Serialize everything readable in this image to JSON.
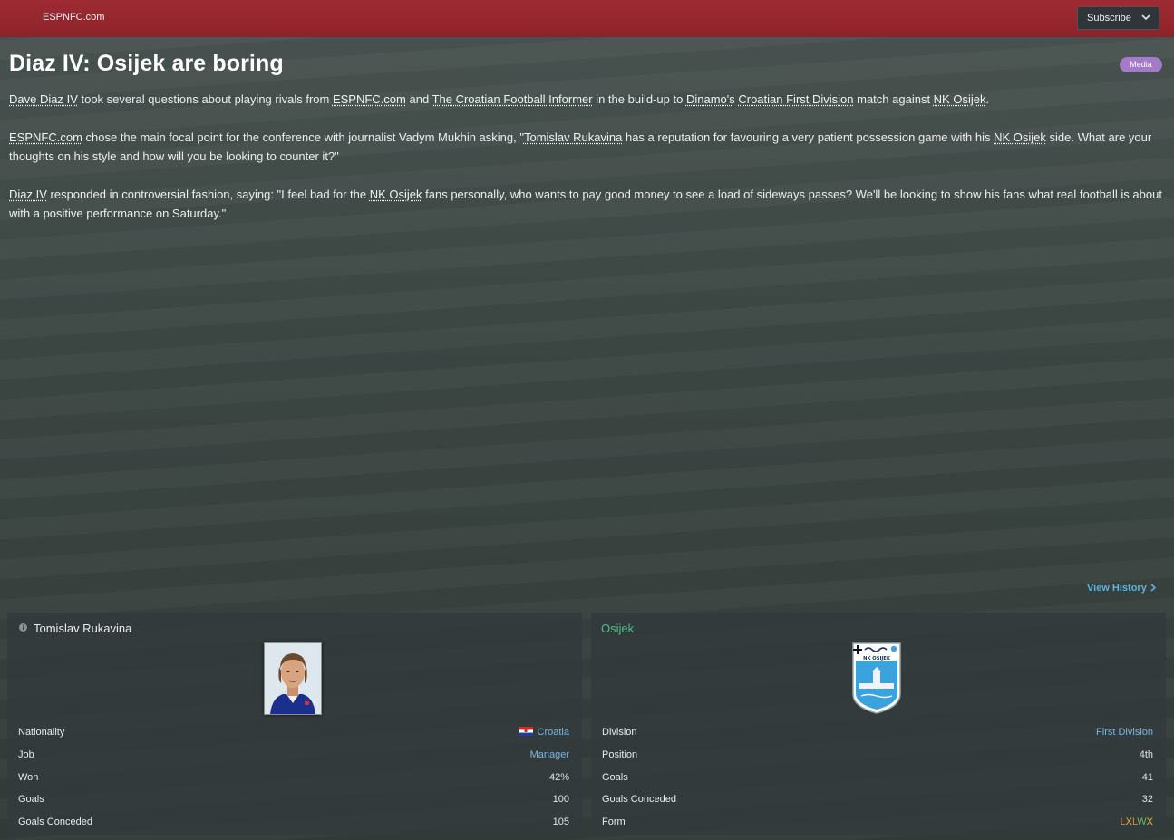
{
  "header": {
    "source_name": "ESPNFC.com",
    "subscribe_label": "Subscribe"
  },
  "article": {
    "headline": "Diaz IV: Osijek are boring",
    "badge": "Media",
    "p1": {
      "a": "Dave Diaz IV",
      "b": " took several questions about playing rivals from ",
      "c": "ESPNFC.com",
      "d": " and ",
      "e": "The Croatian Football Informer",
      "f": " in the build-up to ",
      "g": "Dinamo's",
      "h": " ",
      "i": "Croatian First Division",
      "j": " match against ",
      "k": "NK Osijek",
      "l": "."
    },
    "p2": {
      "a": "ESPNFC.com",
      "b": " chose the main focal point for the conference with journalist Vadym Mukhin asking, \"",
      "c": "Tomislav Rukavina",
      "d": " has a reputation for favouring a very patient possession game with his ",
      "e": "NK Osijek",
      "f": " side. What are your thoughts on his style and how will you be looking to counter it?\""
    },
    "p3": {
      "a": "Diaz IV",
      "b": " responded in controversial fashion, saying: \"I feel bad for the ",
      "c": "NK Osijek",
      "d": " fans personally, who wants to pay good money to see a load of sideways passes? We'll be looking to show his fans what real football is about with a positive performance on Saturday.\""
    }
  },
  "view_history_label": "View History",
  "manager_panel": {
    "name": "Tomislav Rukavina",
    "rows": [
      {
        "label": "Nationality",
        "value": "Croatia"
      },
      {
        "label": "Job",
        "value": "Manager"
      },
      {
        "label": "Won",
        "value": "42%"
      },
      {
        "label": "Goals",
        "value": "100"
      },
      {
        "label": "Goals Conceded",
        "value": "105"
      }
    ]
  },
  "club_panel": {
    "name": "Osijek",
    "crest_text": "NK OSIJEK",
    "rows": [
      {
        "label": "Division",
        "value": "First Division"
      },
      {
        "label": "Position",
        "value": "4th"
      },
      {
        "label": "Goals",
        "value": "41"
      },
      {
        "label": "Goals Conceded",
        "value": "32"
      },
      {
        "label": "Form",
        "value": ""
      }
    ],
    "form": [
      {
        "result": "L",
        "color": "#e8872c"
      },
      {
        "result": "X",
        "color": "#e8b73a"
      },
      {
        "result": "L",
        "color": "#e8872c"
      },
      {
        "result": "W",
        "color": "#5cc06a"
      },
      {
        "result": "X",
        "color": "#e8b73a"
      }
    ]
  },
  "colors": {
    "topbar": "#9e2b33",
    "link_blue": "#77b7e5",
    "club_green": "#4fbd8a",
    "badge_purple": "#a57ac9"
  },
  "icons": [
    "chevron-down-icon",
    "chevron-right-icon",
    "info-icon",
    "croatia-flag-icon"
  ]
}
